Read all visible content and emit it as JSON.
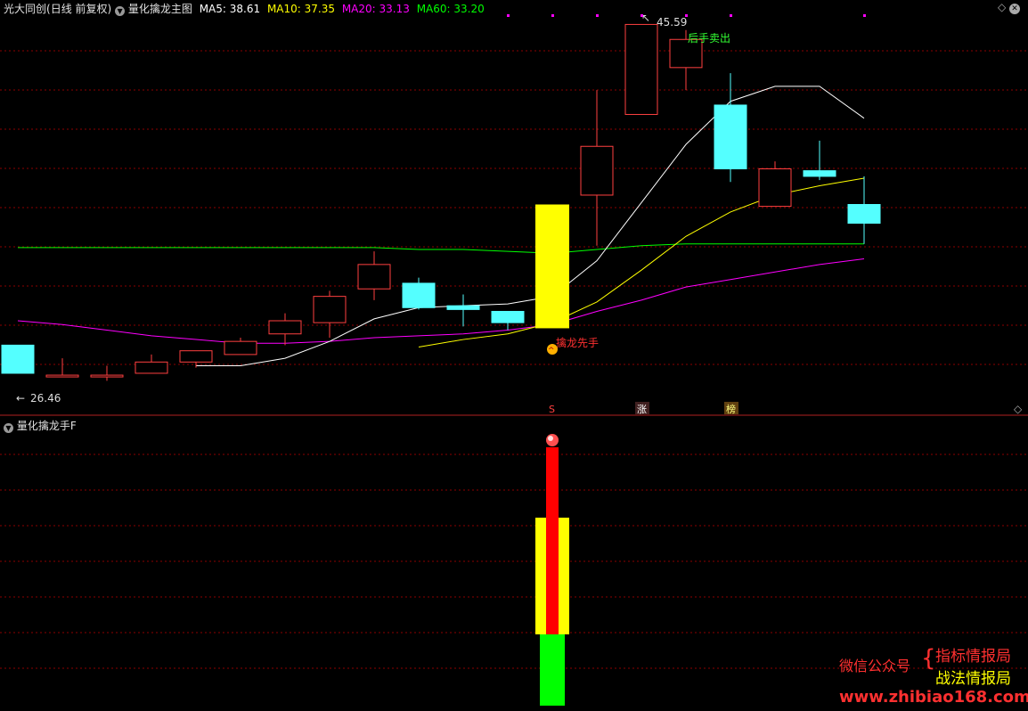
{
  "main_header": {
    "stock_name": "光大同创",
    "period": "(日线 前复权)",
    "indicator_name": "量化擒龙主图",
    "ma5": "MA5: 38.61",
    "ma10": "MA10: 37.35",
    "ma20": "MA20: 33.13",
    "ma60": "MA60: 33.20"
  },
  "sub_header": {
    "indicator_name": "量化擒龙手F"
  },
  "annotations": {
    "high_label": "45.59",
    "low_label": "26.46",
    "buy_signal": "擒龙先手",
    "sell_signal": "后手卖出",
    "marker_s": "S",
    "marker_zhang": "涨",
    "marker_bang": "榜"
  },
  "watermark": {
    "wechat": "微信公众号",
    "name1": "指标情报局",
    "name2": "战法情报局",
    "url": "www.zhibiao168.com"
  },
  "colors": {
    "up": "#ff4040",
    "down": "#54ffff",
    "ma5": "#ffffff",
    "ma10": "#ffff00",
    "ma20": "#ff00ff",
    "ma60": "#00ff00",
    "grid": "#8b0000",
    "signal_bar": "#ffff00"
  },
  "chart_data": [
    {
      "type": "candlestick",
      "title": "量化擒龙主图",
      "ylim": [
        26.0,
        46.0
      ],
      "candles": [
        {
          "o": 28.5,
          "h": 28.5,
          "l": 27.0,
          "c": 27.0
        },
        {
          "o": 26.9,
          "h": 27.8,
          "l": 26.8,
          "c": 26.9
        },
        {
          "o": 26.9,
          "h": 27.4,
          "l": 26.6,
          "c": 26.9
        },
        {
          "o": 27.0,
          "h": 28.0,
          "l": 27.0,
          "c": 27.6
        },
        {
          "o": 27.6,
          "h": 28.2,
          "l": 27.3,
          "c": 28.2
        },
        {
          "o": 28.0,
          "h": 28.9,
          "l": 28.0,
          "c": 28.7
        },
        {
          "o": 29.1,
          "h": 30.2,
          "l": 28.5,
          "c": 29.8
        },
        {
          "o": 29.7,
          "h": 31.4,
          "l": 28.9,
          "c": 31.1
        },
        {
          "o": 31.5,
          "h": 33.5,
          "l": 30.9,
          "c": 32.8
        },
        {
          "o": 31.8,
          "h": 32.1,
          "l": 30.4,
          "c": 30.5
        },
        {
          "o": 30.6,
          "h": 31.2,
          "l": 29.5,
          "c": 30.4
        },
        {
          "o": 30.3,
          "h": 30.3,
          "l": 29.3,
          "c": 29.7
        },
        {
          "o": 29.4,
          "h": 36.0,
          "l": 29.4,
          "c": 36.0
        },
        {
          "o": 36.5,
          "h": 42.1,
          "l": 33.8,
          "c": 39.1
        },
        {
          "o": 40.8,
          "h": 45.6,
          "l": 40.8,
          "c": 45.6
        },
        {
          "o": 43.3,
          "h": 45.3,
          "l": 42.1,
          "c": 44.8
        },
        {
          "o": 41.3,
          "h": 43.0,
          "l": 37.2,
          "c": 37.9
        },
        {
          "o": 35.9,
          "h": 38.3,
          "l": 35.9,
          "c": 37.9
        },
        {
          "o": 37.8,
          "h": 39.4,
          "l": 37.3,
          "c": 37.5
        },
        {
          "o": 36.0,
          "h": 37.5,
          "l": 33.9,
          "c": 35.0
        }
      ],
      "ma5": [
        null,
        null,
        null,
        null,
        27.4,
        27.4,
        27.8,
        28.7,
        29.9,
        30.5,
        30.6,
        30.7,
        31.1,
        33.0,
        36.1,
        39.2,
        41.5,
        42.3,
        42.3,
        40.6
      ],
      "ma10": [
        null,
        null,
        null,
        null,
        null,
        null,
        null,
        null,
        null,
        28.4,
        28.8,
        29.1,
        29.7,
        30.8,
        32.5,
        34.3,
        35.6,
        36.5,
        37.0,
        37.4
      ],
      "ma20": [
        29.8,
        29.6,
        29.3,
        29.0,
        28.8,
        28.6,
        28.6,
        28.7,
        28.9,
        29.0,
        29.1,
        29.3,
        29.6,
        30.3,
        30.9,
        31.6,
        32.0,
        32.4,
        32.8,
        33.1
      ],
      "ma60": [
        33.7,
        33.7,
        33.7,
        33.7,
        33.7,
        33.7,
        33.7,
        33.7,
        33.7,
        33.6,
        33.6,
        33.5,
        33.4,
        33.6,
        33.8,
        33.9,
        33.9,
        33.9,
        33.9,
        33.9
      ],
      "signal_candle_index": 12,
      "sell_candle_index": 15
    },
    {
      "type": "bar",
      "title": "量化擒龙手F",
      "signal_index": 12,
      "segments": [
        "green",
        "yellow",
        "red"
      ]
    }
  ]
}
